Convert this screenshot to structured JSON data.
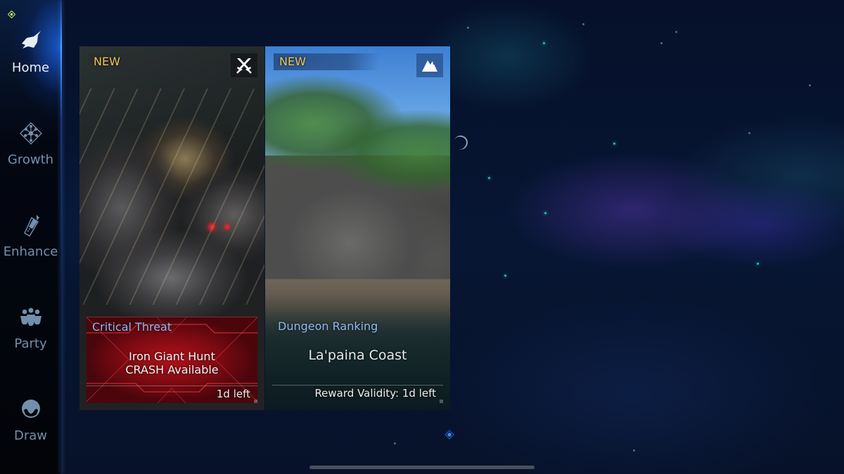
{
  "sidebar": {
    "notification_icon": "diamond-notification-icon",
    "items": [
      {
        "label": "Home",
        "icon": "home-fragment-icon",
        "active": true
      },
      {
        "label": "Growth",
        "icon": "growth-tree-icon",
        "active": false
      },
      {
        "label": "Enhance",
        "icon": "enhance-sword-icon",
        "active": false
      },
      {
        "label": "Party",
        "icon": "party-people-icon",
        "active": false
      },
      {
        "label": "Draw",
        "icon": "draw-orb-icon",
        "active": false
      }
    ]
  },
  "cards": [
    {
      "badge": "NEW",
      "type_icon": "crossed-swords-icon",
      "category": "Critical Threat",
      "title_line1": "Iron Giant Hunt",
      "title_line2": "CRASH Available",
      "footer": "1d left",
      "accent": "#b2121c"
    },
    {
      "badge": "NEW",
      "type_icon": "mountain-icon",
      "category": "Dungeon Ranking",
      "title": "La'paina Coast",
      "footer": "Reward Validity: 1d left",
      "accent": "#8fb8f0"
    }
  ],
  "pager": {
    "current": 1,
    "total": 1
  },
  "colors": {
    "badge_gold": "#f0c453",
    "category_blue": "#8fb8f0",
    "nav_inactive": "#7290ad",
    "nav_active": "#e8eef5"
  }
}
